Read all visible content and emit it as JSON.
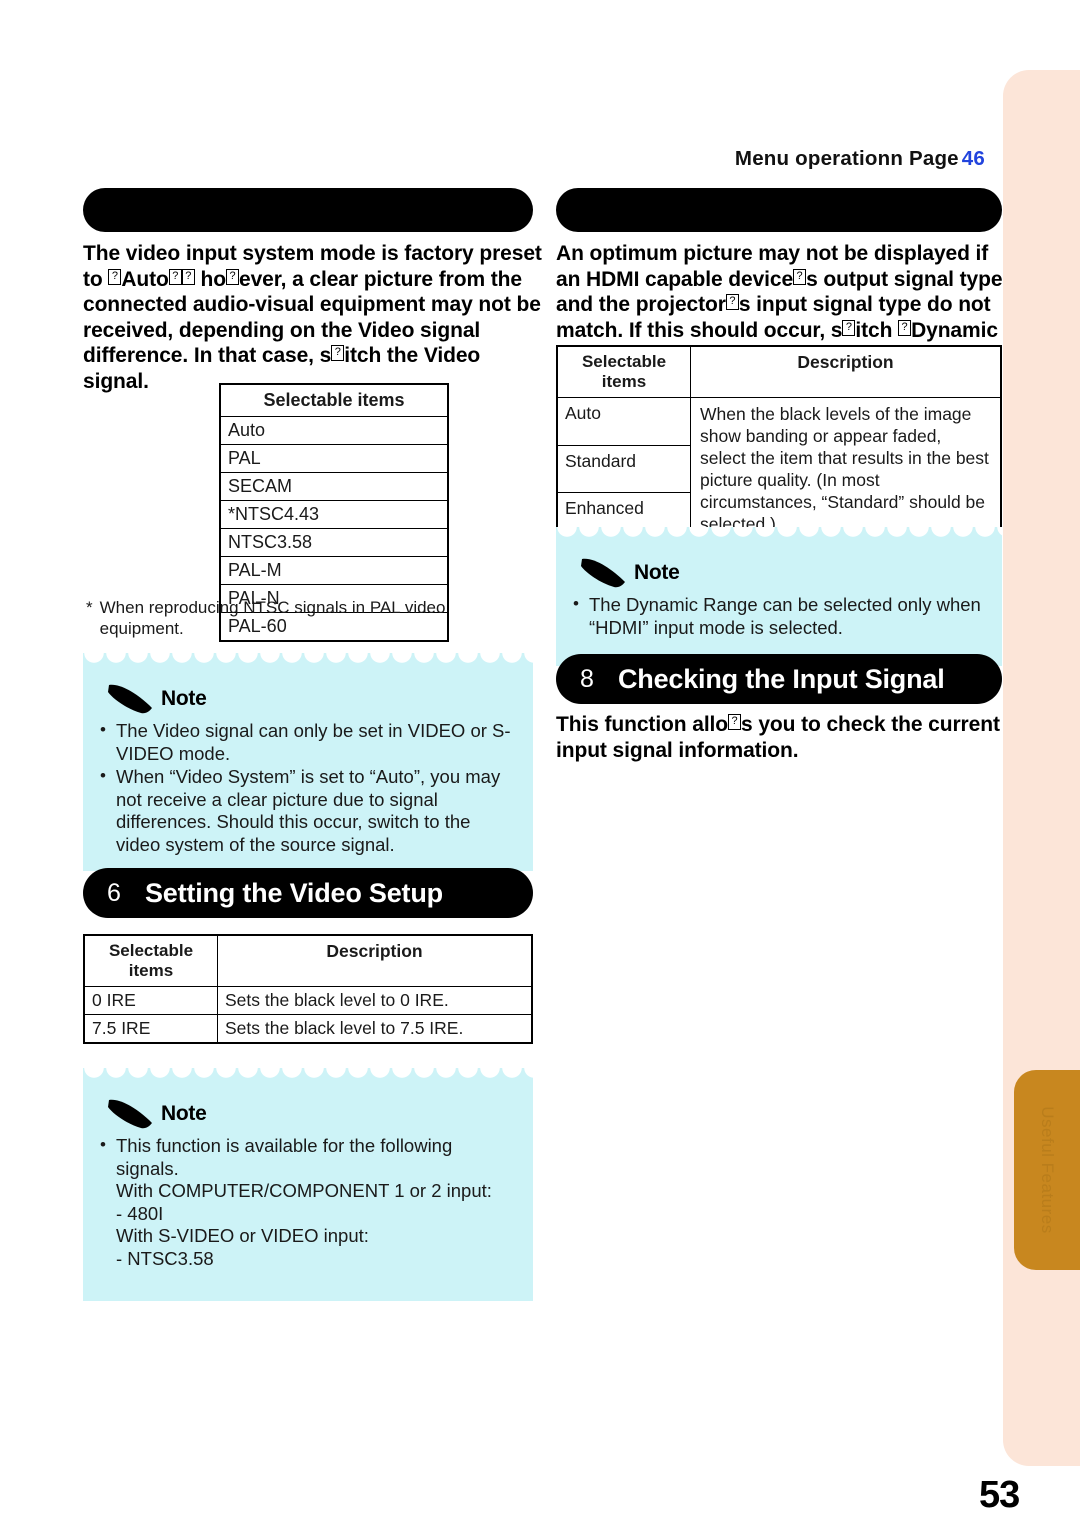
{
  "header": {
    "menu_operation": "Menu operation",
    "menu_operation_marker": "n",
    "page_label": "Page",
    "page_ref": "46"
  },
  "page_number": "53",
  "edge": {
    "tab_label": "Useful Features"
  },
  "left_column": {
    "section_pill": {
      "label": "",
      "redacted": true
    },
    "intro_parts": [
      {
        "t": "The video input system mode is factory preset to "
      },
      {
        "box": "“"
      },
      {
        "t": "Auto"
      },
      {
        "box": "”"
      },
      {
        "box": ";"
      },
      {
        "t": " ho"
      },
      {
        "box": "w"
      },
      {
        "t": "ever, a clear picture from the connected audio-visual equipment may not be received, depending on the Video signal difference. In that case, s"
      },
      {
        "box": "w"
      },
      {
        "t": "itch the Video signal."
      }
    ],
    "items_table": {
      "header": "Selectable items",
      "rows": [
        "Auto",
        "PAL",
        "SECAM",
        "*NTSC4.43",
        "NTSC3.58",
        "PAL-M",
        "PAL-N",
        "PAL-60"
      ]
    },
    "footnote": {
      "marker": "*",
      "text": "When reproducing NTSC signals in PAL video equipment."
    },
    "note": {
      "title": "Note",
      "items": [
        {
          "main": "The Video signal can only be set in VIDEO or S-VIDEO mode.",
          "subs": []
        },
        {
          "main": "When “Video System” is set to “Auto”, you may not receive a clear picture due to signal differences. Should this occur, switch to the video system of the source signal.",
          "subs": []
        }
      ]
    },
    "setup_pill": {
      "number": "6",
      "title": "Setting the Video Setup"
    },
    "ire_table": {
      "col1_header_line1": "Selectable",
      "col1_header_line2": "items",
      "col2_header": "Description",
      "rows": [
        {
          "item": "0 IRE",
          "desc": "Sets the black level to 0 IRE."
        },
        {
          "item": "7.5 IRE",
          "desc": "Sets the black level to 7.5 IRE."
        }
      ]
    },
    "note2": {
      "title": "Note",
      "items": [
        {
          "main": "This function is available for the following signals.",
          "subs": [
            "With COMPUTER/COMPONENT 1 or 2 input:",
            "- 480I",
            "With S-VIDEO or VIDEO input:",
            "- NTSC3.58"
          ]
        }
      ]
    }
  },
  "right_column": {
    "section_pill": {
      "label": "",
      "redacted": true
    },
    "intro_parts": [
      {
        "t": "An optimum picture may not be displayed if an HDMI capable device"
      },
      {
        "box": "’"
      },
      {
        "t": "s output signal type and the projector"
      },
      {
        "box": "’"
      },
      {
        "t": "s input signal type do not match. If this should occur, s"
      },
      {
        "box": "w"
      },
      {
        "t": "itch "
      },
      {
        "box": "“"
      },
      {
        "t": "Dynamic Range"
      },
      {
        "box": "”"
      },
      {
        "t": "."
      }
    ],
    "dynamic_table": {
      "col1_header_line1": "Selectable",
      "col1_header_line2": "items",
      "col2_header": "Description",
      "items": [
        "Auto",
        "Standard",
        "Enhanced"
      ],
      "description": "When the black levels of the image show banding or appear faded, select the item that results in the best picture quality. (In most circumstances, “Standard” should be selected.)"
    },
    "note": {
      "title": "Note",
      "items": [
        {
          "main": "The Dynamic Range can be selected only when “HDMI” input mode is selected.",
          "subs": []
        }
      ]
    },
    "checking_pill": {
      "number": "8",
      "title": "Checking the Input Signal"
    },
    "checking_parts": [
      {
        "t": "This function allo"
      },
      {
        "box": "w"
      },
      {
        "t": "s you to check the current input signal information."
      }
    ]
  }
}
